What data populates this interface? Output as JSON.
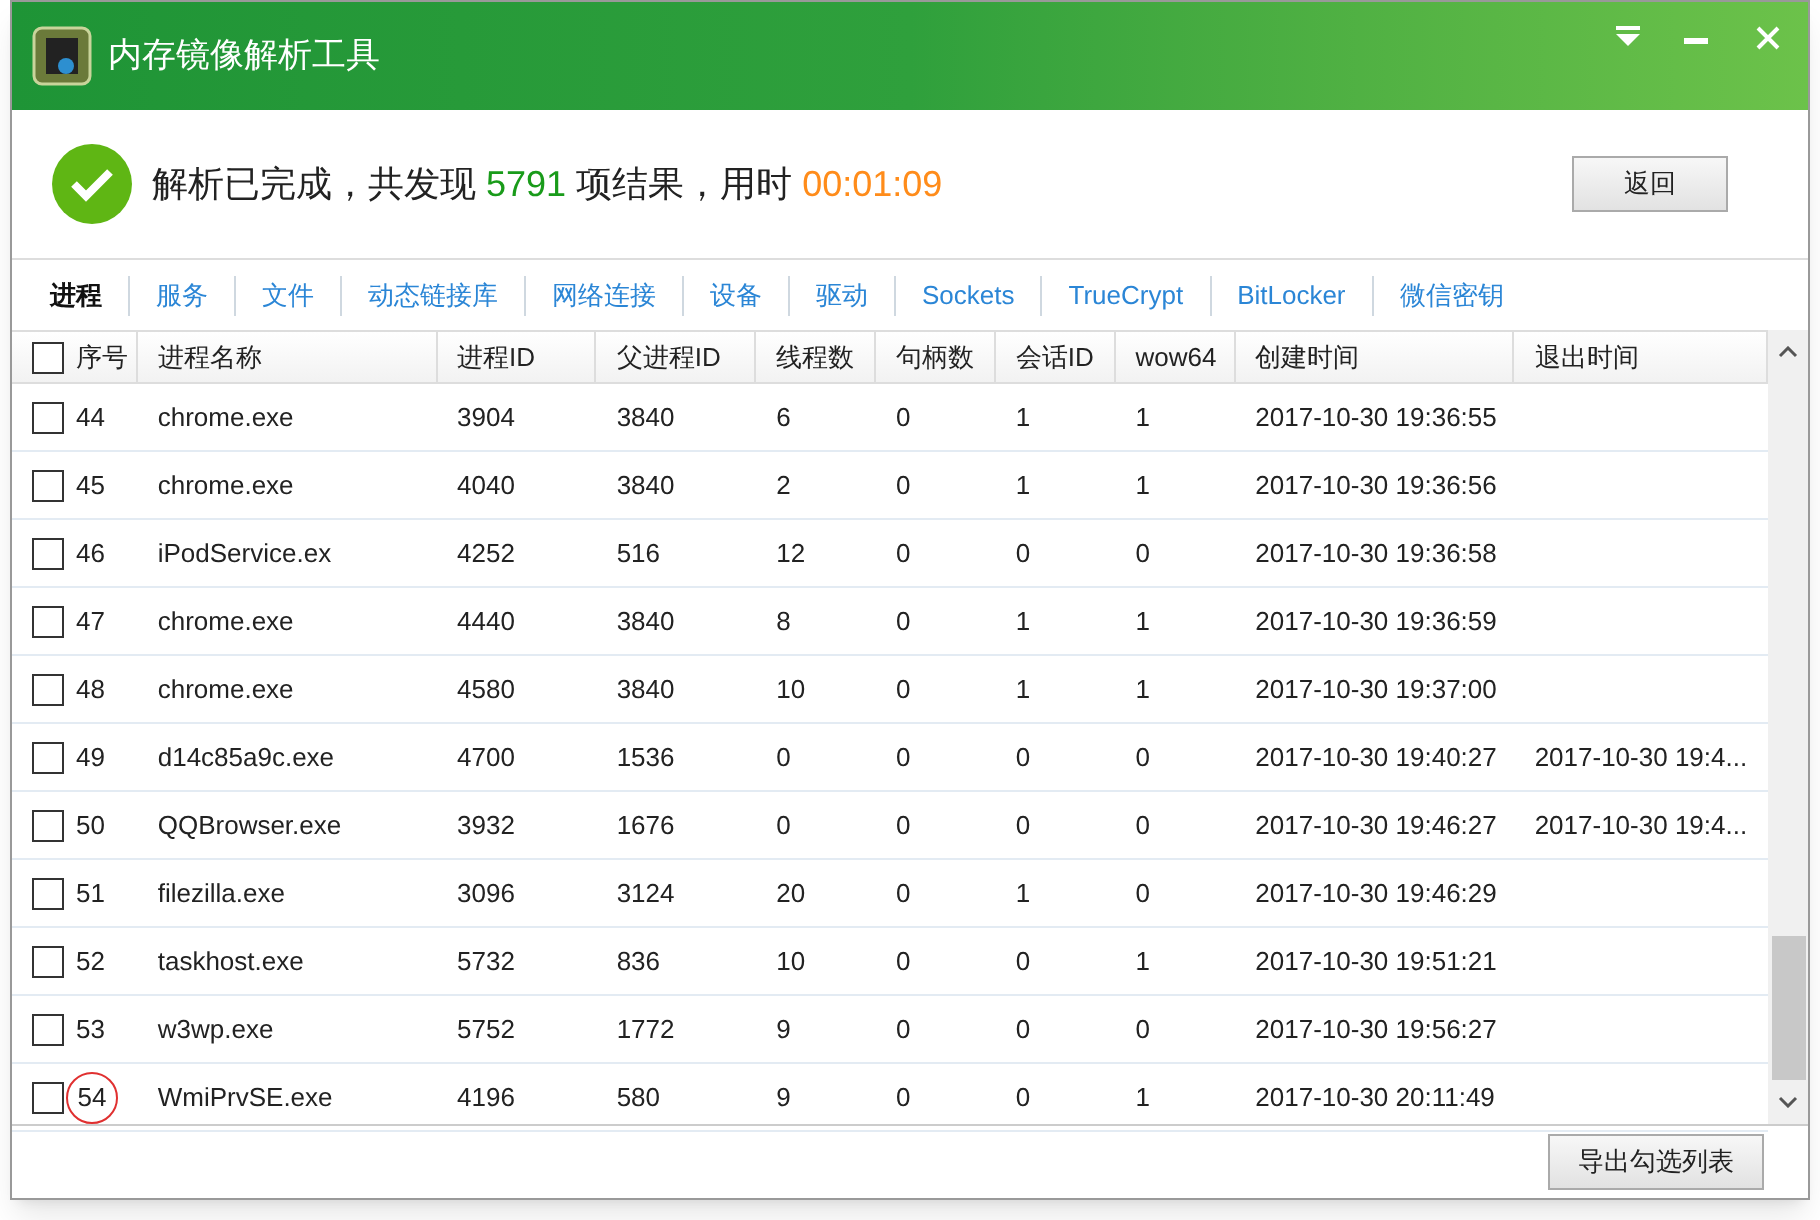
{
  "window": {
    "title": "内存镜像解析工具"
  },
  "summary": {
    "prefix": "解析已完成，共发现",
    "count": "5791",
    "middle": "项结果，用时",
    "duration": "00:01:09"
  },
  "back_button": "返回",
  "tabs": [
    {
      "label": "进程",
      "selected": true
    },
    {
      "label": "服务",
      "selected": false
    },
    {
      "label": "文件",
      "selected": false
    },
    {
      "label": "动态链接库",
      "selected": false
    },
    {
      "label": "网络连接",
      "selected": false
    },
    {
      "label": "设备",
      "selected": false
    },
    {
      "label": "驱动",
      "selected": false
    },
    {
      "label": "Sockets",
      "selected": false
    },
    {
      "label": "TrueCrypt",
      "selected": false
    },
    {
      "label": "BitLocker",
      "selected": false
    },
    {
      "label": "微信密钥",
      "selected": false
    }
  ],
  "table": {
    "select_all_checked": false,
    "columns": [
      "序号",
      "进程名称",
      "进程ID",
      "父进程ID",
      "线程数",
      "句柄数",
      "会话ID",
      "wow64",
      "创建时间",
      "退出时间"
    ],
    "rows": [
      {
        "checked": false,
        "circled": false,
        "cells": [
          "44",
          "chrome.exe",
          "3904",
          "3840",
          "6",
          "0",
          "1",
          "1",
          "2017-10-30 19:36:55",
          ""
        ]
      },
      {
        "checked": false,
        "circled": false,
        "cells": [
          "45",
          "chrome.exe",
          "4040",
          "3840",
          "2",
          "0",
          "1",
          "1",
          "2017-10-30 19:36:56",
          ""
        ]
      },
      {
        "checked": false,
        "circled": false,
        "cells": [
          "46",
          "iPodService.ex",
          "4252",
          "516",
          "12",
          "0",
          "0",
          "0",
          "2017-10-30 19:36:58",
          ""
        ]
      },
      {
        "checked": false,
        "circled": false,
        "cells": [
          "47",
          "chrome.exe",
          "4440",
          "3840",
          "8",
          "0",
          "1",
          "1",
          "2017-10-30 19:36:59",
          ""
        ]
      },
      {
        "checked": false,
        "circled": false,
        "cells": [
          "48",
          "chrome.exe",
          "4580",
          "3840",
          "10",
          "0",
          "1",
          "1",
          "2017-10-30 19:37:00",
          ""
        ]
      },
      {
        "checked": false,
        "circled": false,
        "cells": [
          "49",
          "d14c85a9c.exe",
          "4700",
          "1536",
          "0",
          "0",
          "0",
          "0",
          "2017-10-30 19:40:27",
          "2017-10-30 19:4..."
        ]
      },
      {
        "checked": false,
        "circled": false,
        "cells": [
          "50",
          "QQBrowser.exe",
          "3932",
          "1676",
          "0",
          "0",
          "0",
          "0",
          "2017-10-30 19:46:27",
          "2017-10-30 19:4..."
        ]
      },
      {
        "checked": false,
        "circled": false,
        "cells": [
          "51",
          "filezilla.exe",
          "3096",
          "3124",
          "20",
          "0",
          "1",
          "0",
          "2017-10-30 19:46:29",
          ""
        ]
      },
      {
        "checked": false,
        "circled": false,
        "cells": [
          "52",
          "taskhost.exe",
          "5732",
          "836",
          "10",
          "0",
          "0",
          "1",
          "2017-10-30 19:51:21",
          ""
        ]
      },
      {
        "checked": false,
        "circled": false,
        "cells": [
          "53",
          "w3wp.exe",
          "5752",
          "1772",
          "9",
          "0",
          "0",
          "0",
          "2017-10-30 19:56:27",
          ""
        ]
      },
      {
        "checked": false,
        "circled": true,
        "cells": [
          "54",
          "WmiPrvSE.exe",
          "4196",
          "580",
          "9",
          "0",
          "0",
          "1",
          "2017-10-30 20:11:49",
          ""
        ]
      }
    ]
  },
  "export_button": "导出勾选列表"
}
